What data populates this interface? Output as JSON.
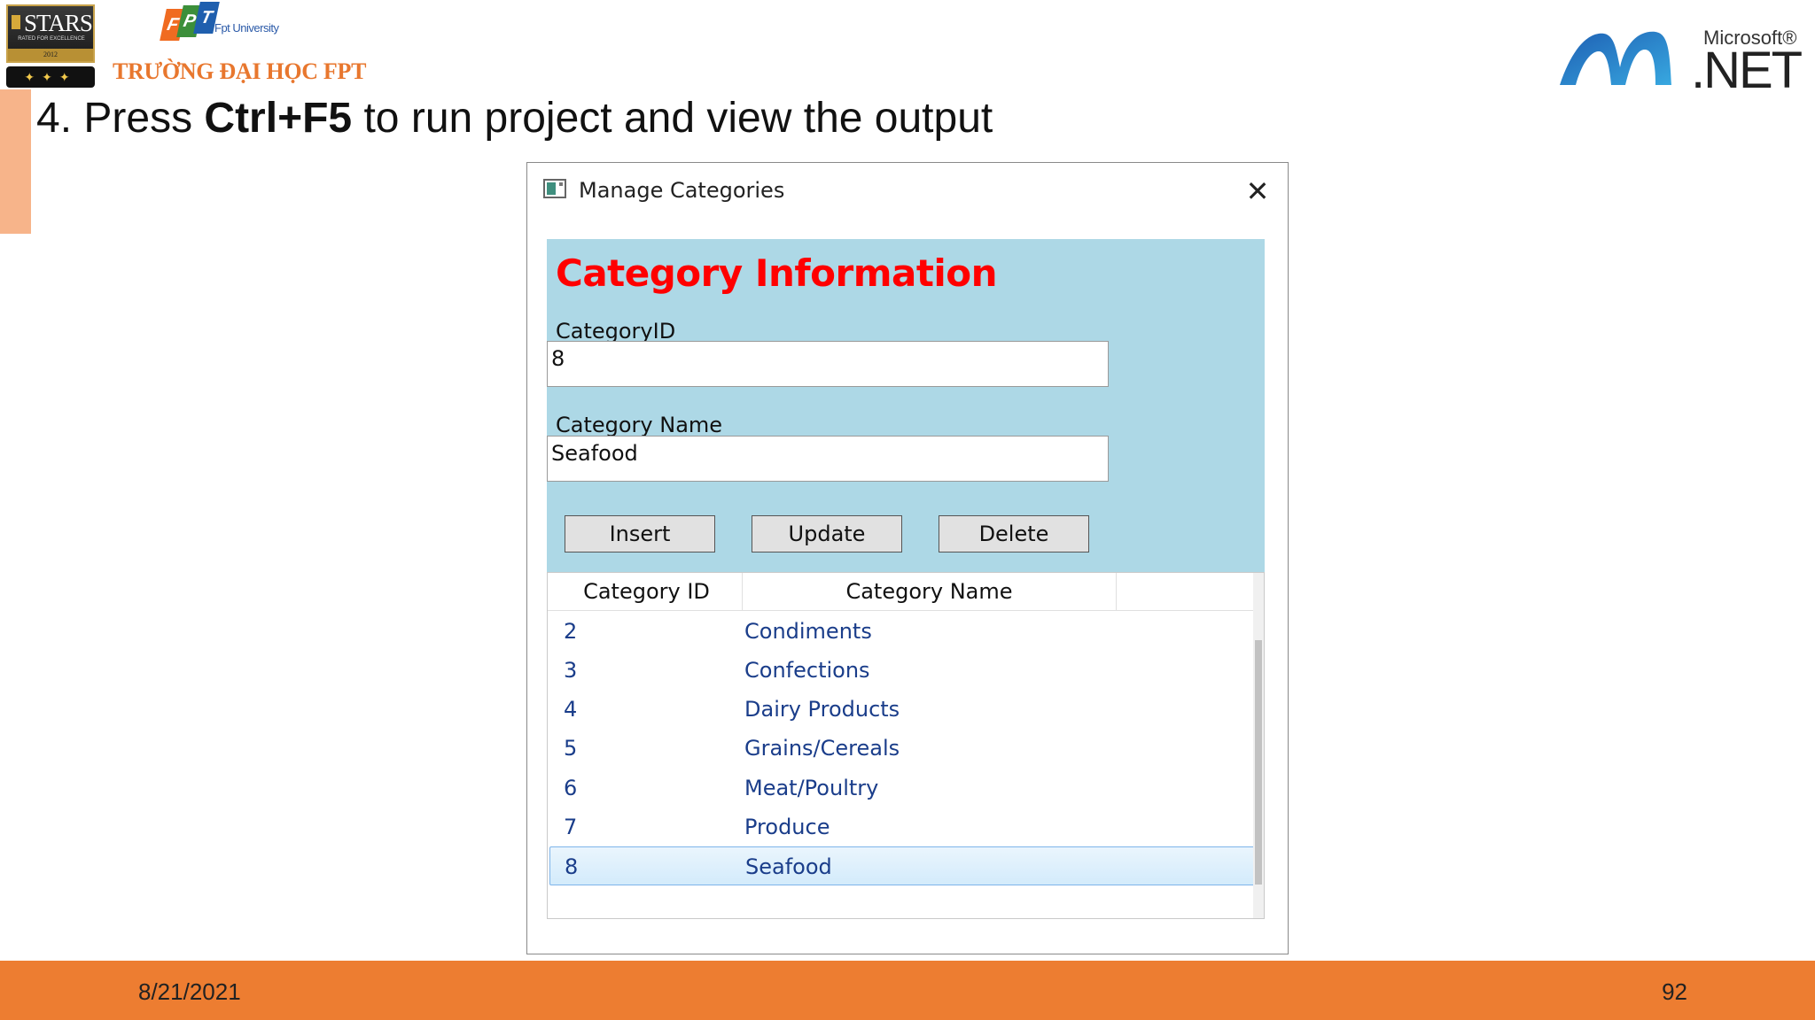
{
  "header": {
    "stars_logo": {
      "word": "STARS",
      "subtitle": "RATED FOR EXCELLENCE",
      "year": "2012"
    },
    "fpt_logo": {
      "letters": [
        "F",
        "P",
        "T"
      ],
      "university": "Fpt University",
      "caption": "TRƯỜNG ĐẠI HỌC FPT"
    },
    "dotnet_logo": {
      "microsoft": "Microsoft®",
      "net": ".NET"
    }
  },
  "slide": {
    "heading_prefix": "4. Press ",
    "heading_bold": "Ctrl+F5",
    "heading_suffix": " to run project and view the output"
  },
  "window": {
    "title": "Manage Categories",
    "close_symbol": "✕",
    "panel": {
      "heading": "Category Information",
      "category_id_label": "CategoryID",
      "category_id_value": "8",
      "category_name_label": "Category Name",
      "category_name_value": "Seafood",
      "buttons": {
        "insert": "Insert",
        "update": "Update",
        "delete": "Delete"
      }
    },
    "list": {
      "columns": [
        "Category ID",
        "Category Name"
      ],
      "rows": [
        {
          "id": "2",
          "name": "Condiments"
        },
        {
          "id": "3",
          "name": "Confections"
        },
        {
          "id": "4",
          "name": "Dairy Products"
        },
        {
          "id": "5",
          "name": "Grains/Cereals"
        },
        {
          "id": "6",
          "name": "Meat/Poultry"
        },
        {
          "id": "7",
          "name": "Produce"
        },
        {
          "id": "8",
          "name": "Seafood"
        }
      ],
      "selected_index": 6
    }
  },
  "footer": {
    "date": "8/21/2021",
    "page_number": "92"
  },
  "colors": {
    "panel_bg": "#add8e6",
    "heading_red": "#ff0000",
    "footer_orange": "#ed7d31",
    "accent_bar": "#f7b48a",
    "list_text": "#1a3d8a"
  }
}
